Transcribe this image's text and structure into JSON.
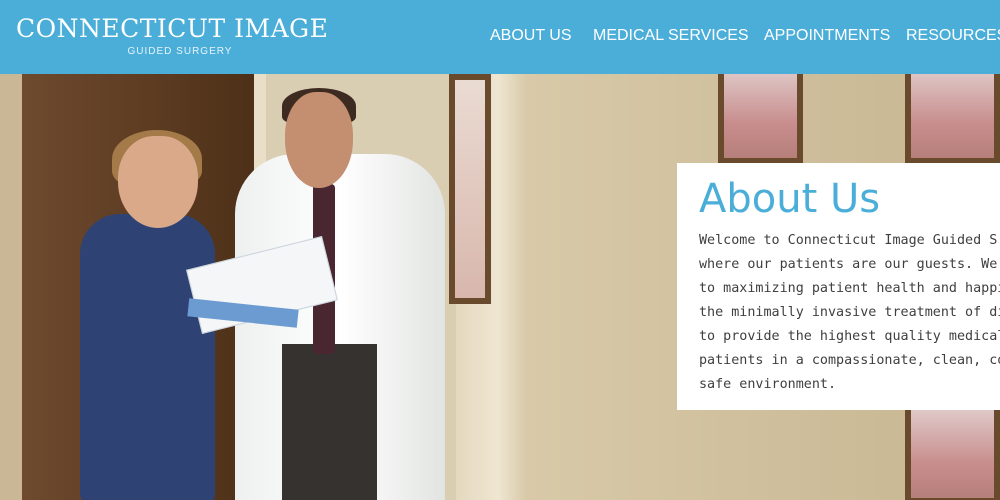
{
  "header": {
    "logo_title": "CONNECTICUT IMAGE",
    "logo_subtitle": "GUIDED SURGERY",
    "nav": [
      {
        "label": "ABOUT US"
      },
      {
        "label": "MEDICAL SERVICES"
      },
      {
        "label": "APPOINTMENTS"
      },
      {
        "label": "RESOURCES"
      }
    ]
  },
  "about": {
    "title": "About Us",
    "lines": [
      "Welcome to Connecticut Image Guided S",
      "where our patients are our guests. We ar",
      "to maximizing patient health and happine",
      "the minimally invasive treatment of dise",
      "to provide the highest quality medical ca",
      "patients in a compassionate, clean, comf",
      "safe environment."
    ]
  },
  "colors": {
    "header_bg": "#4aaed9",
    "accent": "#4aaed9",
    "text": "#3f3f3f"
  }
}
